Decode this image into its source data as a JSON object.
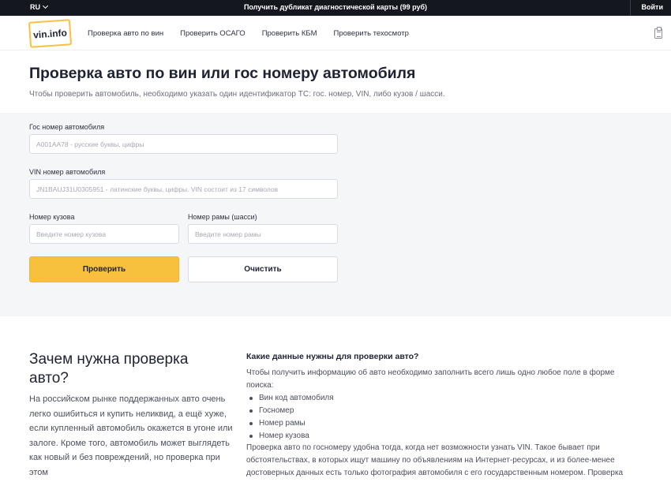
{
  "topbar": {
    "language": "RU",
    "promo": "Получить дубликат диагностической карты (99 руб)",
    "login": "Войти"
  },
  "header": {
    "logo": "vin.info",
    "nav": [
      "Проверка авто по вин",
      "Проверить ОСАГО",
      "Проверить КБМ",
      "Проверить техосмотр"
    ]
  },
  "hero": {
    "title": "Проверка авто по вин или гос номеру автомобиля",
    "subtitle": "Чтобы проверить автомобиль, необходимо указать один идентификатор ТС: гос. номер, VIN, либо кузов / шасси."
  },
  "form": {
    "gos_label": "Гос номер автомобиля",
    "gos_placeholder": "А001АА78 - русские буквы, цифры",
    "vin_label": "VIN номер автомобиля",
    "vin_placeholder": "JN1BAUJ31U0305951 - латинские буквы, цифры. VIN состоит из 17 символов",
    "body_label": "Номер кузова",
    "body_placeholder": "Введите номер кузова",
    "frame_label": "Номер рамы (шасси)",
    "frame_placeholder": "Введите номер рамы",
    "check_button": "Проверить",
    "clear_button": "Очистить"
  },
  "why": {
    "title": "Зачем нужна проверка авто?",
    "text": "На российском рынке поддержанных авто очень легко ошибиться и купить неликвид, а ещё хуже, если купленный автомобиль окажется в угоне или залоге. Кроме того, автомобиль может выглядеть как новый и без повреждений, но проверка при этом"
  },
  "info": {
    "title": "Какие данные нужны для проверки авто?",
    "text": "Чтобы получить информацию об авто необходимо заполнить всего лишь одно любое поле в форме поиска:",
    "list": [
      "Вин код автомобиля",
      "Госномер",
      "Номер рамы",
      "Номер кузова"
    ],
    "text2": "Проверка авто по госномеру удобна тогда, когда нет возможности узнать VIN. Такое бывает при обстоятельствах, в которых ищут машину по объявлениям на Интернет-ресурсах, и из более-менее достоверных данных есть только фотография автомобиля с его государственным номером. Проверка"
  },
  "colors": {
    "topbar": "#15171f",
    "accent": "#f7c13e",
    "form_background": "#f5f6f8"
  },
  "icons": {
    "language_dropdown": "chevron-down-icon",
    "header_right": "clipboard-icon"
  }
}
